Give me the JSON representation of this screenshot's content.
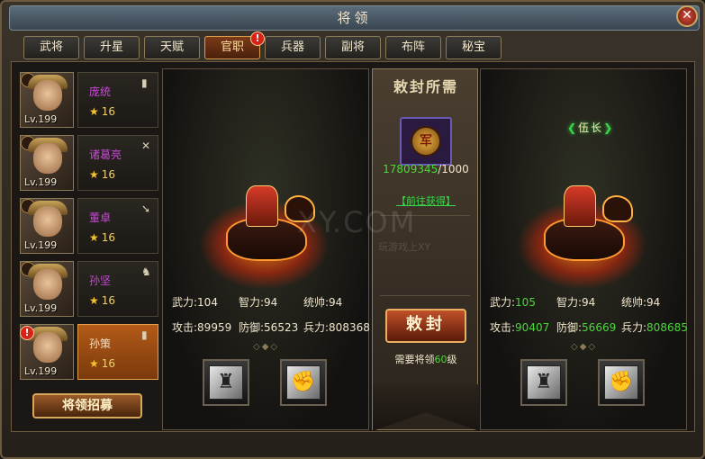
{
  "window": {
    "title": "将领",
    "close_icon": "close-icon"
  },
  "tabs": [
    {
      "label": "武将",
      "active": false,
      "alert": false
    },
    {
      "label": "升星",
      "active": false,
      "alert": false
    },
    {
      "label": "天赋",
      "active": false,
      "alert": false
    },
    {
      "label": "官职",
      "active": true,
      "alert": true
    },
    {
      "label": "兵器",
      "active": false,
      "alert": false
    },
    {
      "label": "副将",
      "active": false,
      "alert": false
    },
    {
      "label": "布阵",
      "active": false,
      "alert": false
    },
    {
      "label": "秘宝",
      "active": false,
      "alert": false
    }
  ],
  "tab_alert_glyph": "!",
  "generals": [
    {
      "name": "庞统",
      "level": "Lv.199",
      "stars": "16",
      "class_icon": "shield-icon",
      "alert": false,
      "selected": false
    },
    {
      "name": "诸葛亮",
      "level": "Lv.199",
      "stars": "16",
      "class_icon": "crossed-swords-icon",
      "alert": false,
      "selected": false
    },
    {
      "name": "董卓",
      "level": "Lv.199",
      "stars": "16",
      "class_icon": "spear-icon",
      "alert": false,
      "selected": false
    },
    {
      "name": "孙坚",
      "level": "Lv.199",
      "stars": "16",
      "class_icon": "horse-icon",
      "alert": false,
      "selected": false
    },
    {
      "name": "孙策",
      "level": "Lv.199",
      "stars": "16",
      "class_icon": "shield-icon",
      "alert": true,
      "selected": true
    }
  ],
  "recruit_button": "将领招募",
  "left_panel": {
    "stats": {
      "wuli_label": "武力:",
      "wuli": "104",
      "zhili_label": "智力:",
      "zhili": "94",
      "tongshuai_label": "统帅:",
      "tongshuai": "94",
      "gongji_label": "攻击:",
      "gongji": "89959",
      "fangyu_label": "防御:",
      "fangyu": "56523",
      "bingli_label": "兵力:",
      "bingli": "808368"
    },
    "ornament": "◇◆◇"
  },
  "middle_panel": {
    "title": "敕封所需",
    "token_glyph": "军",
    "token_have": "17809345",
    "token_sep": "/",
    "token_need": "1000",
    "goto_link": "【前往获得】",
    "confer_button": "敕封",
    "require_prefix": "需要将领",
    "require_level": "60",
    "require_suffix": "级"
  },
  "right_panel": {
    "rank_title": "伍长",
    "stats": {
      "wuli_label": "武力:",
      "wuli": "105",
      "zhili_label": "智力:",
      "zhili": "94",
      "tongshuai_label": "统帅:",
      "tongshuai": "94",
      "gongji_label": "攻击:",
      "gongji": "90407",
      "fangyu_label": "防御:",
      "fangyu": "56669",
      "bingli_label": "兵力:",
      "bingli": "808685"
    },
    "ornament": "◇◆◇"
  },
  "watermark": {
    "text": "XY.COM",
    "sub": "玩游戏上XY"
  },
  "colors": {
    "accent_gold": "#d8a85a",
    "stat_up_green": "#4ad83a",
    "alert_red": "#d62318",
    "name_purple": "#c84ad8"
  }
}
